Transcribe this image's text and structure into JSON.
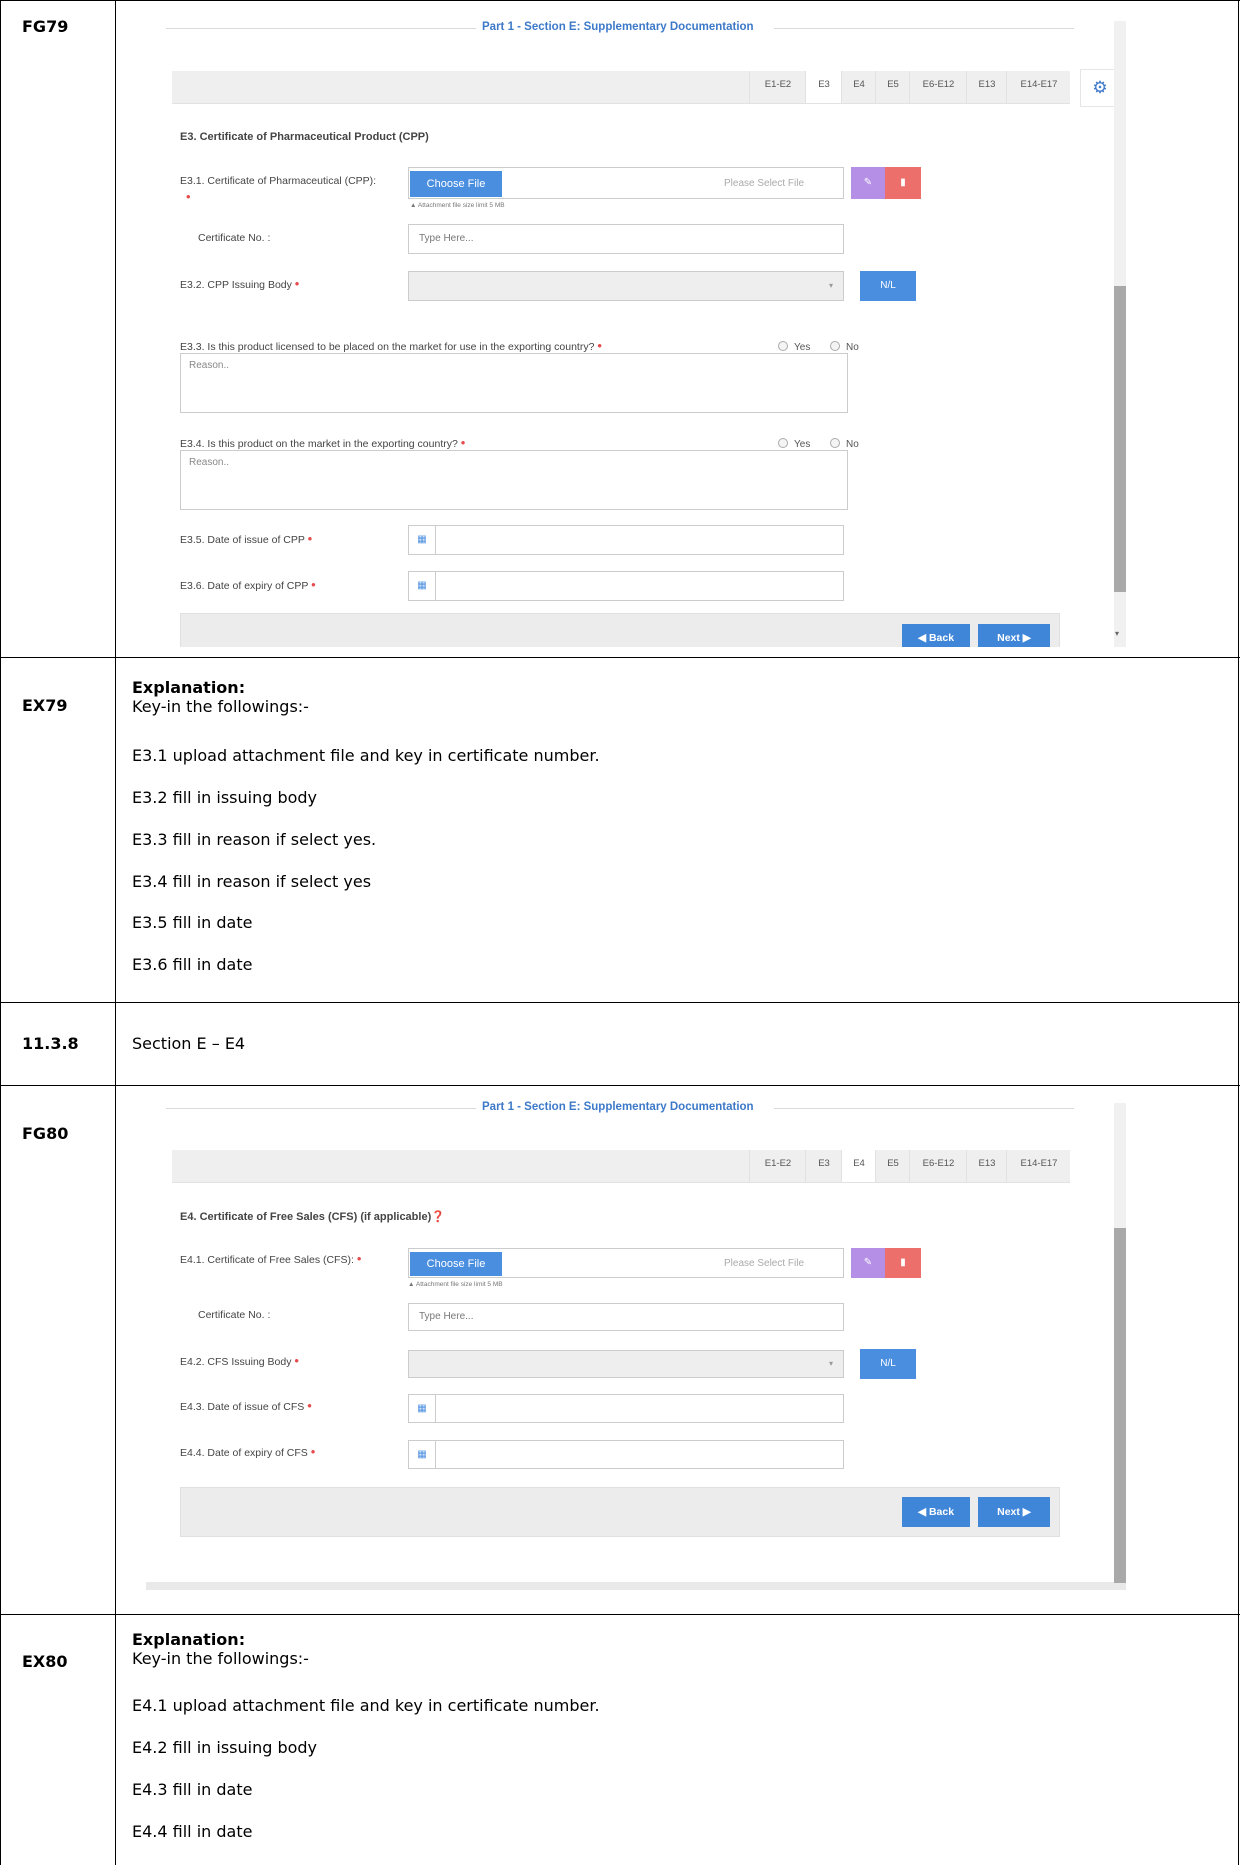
{
  "rows": {
    "fg79": "FG79",
    "ex79": "EX79",
    "r1138": "11.3.8",
    "r1138_text": "Section E – E4",
    "fg80": "FG80",
    "ex80": "EX80"
  },
  "ex79": {
    "heading": "Explanation:",
    "intro": "Key-in the followings:-",
    "items": [
      "E3.1 upload attachment file and key in certificate number.",
      "E3.2 fill in issuing body",
      "E3.3 fill in reason if select yes.",
      "E3.4 fill in reason if select yes",
      "E3.5  fill in date",
      "E3.6  fill in date"
    ]
  },
  "ex80": {
    "heading": "Explanation:",
    "intro": "Key-in the followings:-",
    "items": [
      "E4.1 upload attachment file and key in certificate number.",
      "E4.2 fill in issuing body",
      "E4.3 fill in date",
      "E4.4 fill in date"
    ]
  },
  "panel_title": "Part 1 - Section E: Supplementary Documentation",
  "tabs": [
    "E1-E2",
    "E3",
    "E4",
    "E5",
    "E6-E12",
    "E13",
    "E14-E17"
  ],
  "common": {
    "choose_file": "Choose File",
    "please_select": "Please Select File",
    "attach_limit": "Attachment file size limit 5 MB",
    "cert_no_label": "Certificate No. :",
    "type_here": "Type Here...",
    "nl": "N/L",
    "yes": "Yes",
    "no": "No",
    "reason": "Reason..",
    "back": "Back",
    "next": "Next"
  },
  "fg79_form": {
    "section": "E3. Certificate of Pharmaceutical Product (CPP)",
    "e31": "E3.1. Certificate of Pharmaceutical (CPP):",
    "e32": "E3.2. CPP Issuing Body",
    "e33": "E3.3. Is this product licensed to be placed on the market for use in the exporting country?",
    "e34": "E3.4. Is this product on the market in the exporting country?",
    "e35": "E3.5. Date of issue of CPP",
    "e36": "E3.6. Date of expiry of CPP"
  },
  "fg80_form": {
    "section": "E4. Certificate of Free Sales (CFS) (if applicable)",
    "e41": "E4.1. Certificate of Free Sales (CFS):",
    "e42": "E4.2. CFS Issuing Body",
    "e43": "E4.3. Date of issue of CFS",
    "e44": "E4.4. Date of expiry of CFS"
  },
  "colors": {
    "accent": "#4a8ee0",
    "danger": "#ec6f6b",
    "purple": "#b58ee6",
    "required": "#e54b4b"
  }
}
